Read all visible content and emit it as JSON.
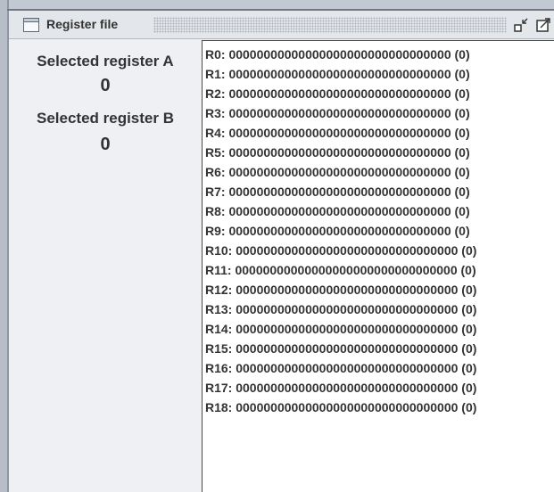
{
  "window": {
    "title": "Register file",
    "icon": "window-icon",
    "controls": [
      "minimize-icon",
      "maximize-icon"
    ]
  },
  "selected": {
    "a_label": "Selected register A",
    "a_value": "0",
    "b_label": "Selected register B",
    "b_value": "0"
  },
  "registers": [
    "R0: 00000000000000000000000000000000 (0)",
    "R1: 00000000000000000000000000000000 (0)",
    "R2: 00000000000000000000000000000000 (0)",
    "R3: 00000000000000000000000000000000 (0)",
    "R4: 00000000000000000000000000000000 (0)",
    "R5: 00000000000000000000000000000000 (0)",
    "R6: 00000000000000000000000000000000 (0)",
    "R7: 00000000000000000000000000000000 (0)",
    "R8: 00000000000000000000000000000000 (0)",
    "R9: 00000000000000000000000000000000 (0)",
    "R10: 00000000000000000000000000000000 (0)",
    "R11: 00000000000000000000000000000000 (0)",
    "R12: 00000000000000000000000000000000 (0)",
    "R13: 00000000000000000000000000000000 (0)",
    "R14: 00000000000000000000000000000000 (0)",
    "R15: 00000000000000000000000000000000 (0)",
    "R16: 00000000000000000000000000000000 (0)",
    "R17: 00000000000000000000000000000000 (0)",
    "R18: 00000000000000000000000000000000 (0)"
  ]
}
